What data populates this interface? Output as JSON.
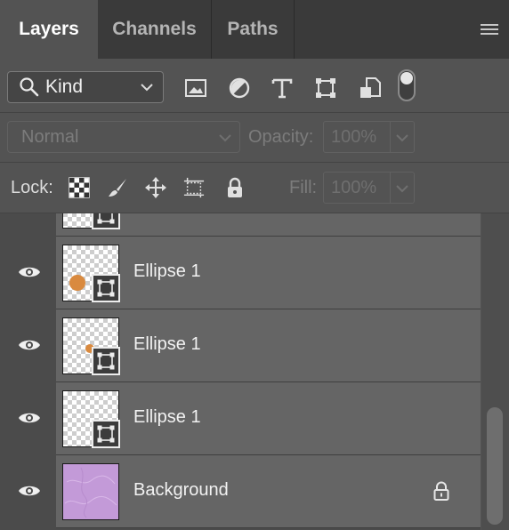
{
  "tabs": [
    {
      "label": "Layers",
      "active": true
    },
    {
      "label": "Channels",
      "active": false
    },
    {
      "label": "Paths",
      "active": false
    }
  ],
  "filter": {
    "kind_label": "Kind",
    "icons": [
      "image-filter-icon",
      "adjustment-filter-icon",
      "type-filter-icon",
      "shape-filter-icon",
      "smart-object-filter-icon"
    ],
    "toggle_on": true
  },
  "blend": {
    "mode": "Normal",
    "opacity_label": "Opacity:",
    "opacity_value": "100%"
  },
  "lock": {
    "label": "Lock:",
    "icons": [
      "lock-transparent-pixels-icon",
      "lock-image-pixels-icon",
      "lock-position-icon",
      "lock-artboard-icon",
      "lock-all-icon"
    ],
    "fill_label": "Fill:",
    "fill_value": "100%"
  },
  "layers": [
    {
      "name": "Ellipse 1",
      "type": "shape",
      "dot": "large",
      "visible": true
    },
    {
      "name": "Ellipse 1",
      "type": "shape",
      "dot": "small",
      "visible": true
    },
    {
      "name": "Ellipse 1",
      "type": "shape",
      "dot": "none",
      "visible": true
    },
    {
      "name": "Background",
      "type": "background",
      "locked": true,
      "visible": true
    }
  ],
  "colors": {
    "panel": "#535353",
    "tabbar": "#3a3a3a",
    "layer_row": "#656565",
    "dot": "#d98a3f",
    "background_thumb": "#c39ad8"
  }
}
